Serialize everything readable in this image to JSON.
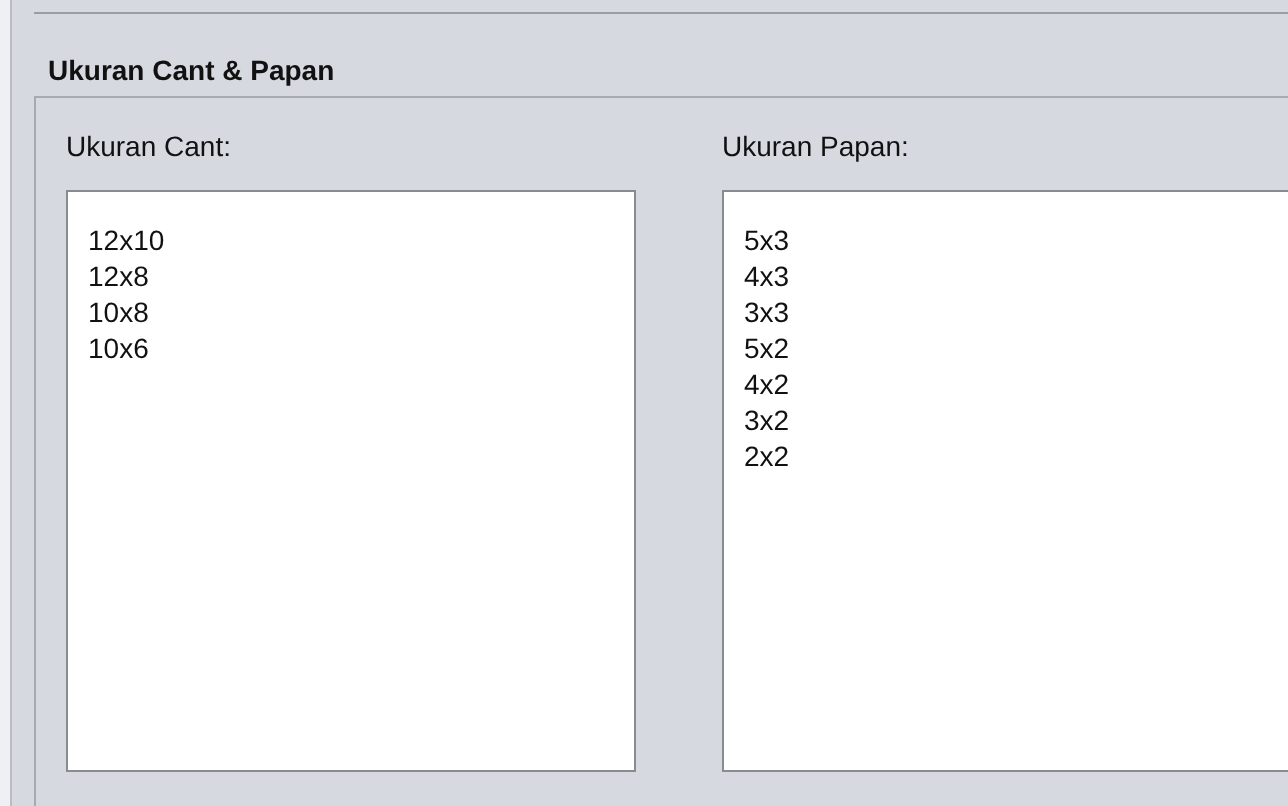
{
  "group": {
    "title": "Ukuran Cant & Papan",
    "lists": [
      {
        "label": "Ukuran Cant:",
        "items": [
          "12x10",
          "12x8",
          "10x8",
          "10x6"
        ]
      },
      {
        "label": "Ukuran Papan:",
        "items": [
          "5x3",
          "4x3",
          "3x3",
          "5x2",
          "4x2",
          "3x2",
          "2x2"
        ]
      }
    ]
  }
}
